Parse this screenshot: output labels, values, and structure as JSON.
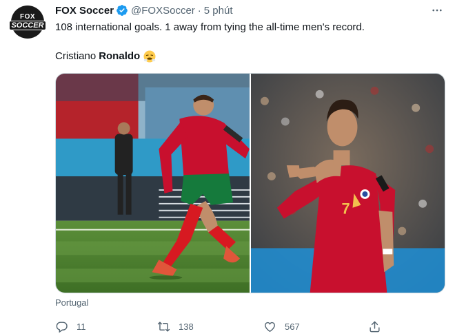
{
  "account": {
    "display_name": "FOX Soccer",
    "handle": "@FOXSoccer",
    "separator": "·",
    "time": "5 phút",
    "logo_top": "FOX",
    "logo_bottom": "SOCCER"
  },
  "tweet": {
    "line1": "108 international goals. 1 away from tying the all-time men's record.",
    "line2_regular": "Cristiano",
    "line2_bold": "Ronaldo",
    "emoji": "face-with-steam-from-nose"
  },
  "media": {
    "left_alt": "Ronaldo taking a penalty kick",
    "right_alt": "Ronaldo celebrating a goal"
  },
  "location": "Portugal",
  "actions": {
    "reply_count": "11",
    "retweet_count": "138",
    "like_count": "567"
  },
  "colors": {
    "text": "#0f1419",
    "secondary": "#536471",
    "verified": "#1d9bf0",
    "jersey_red": "#c8102e"
  }
}
